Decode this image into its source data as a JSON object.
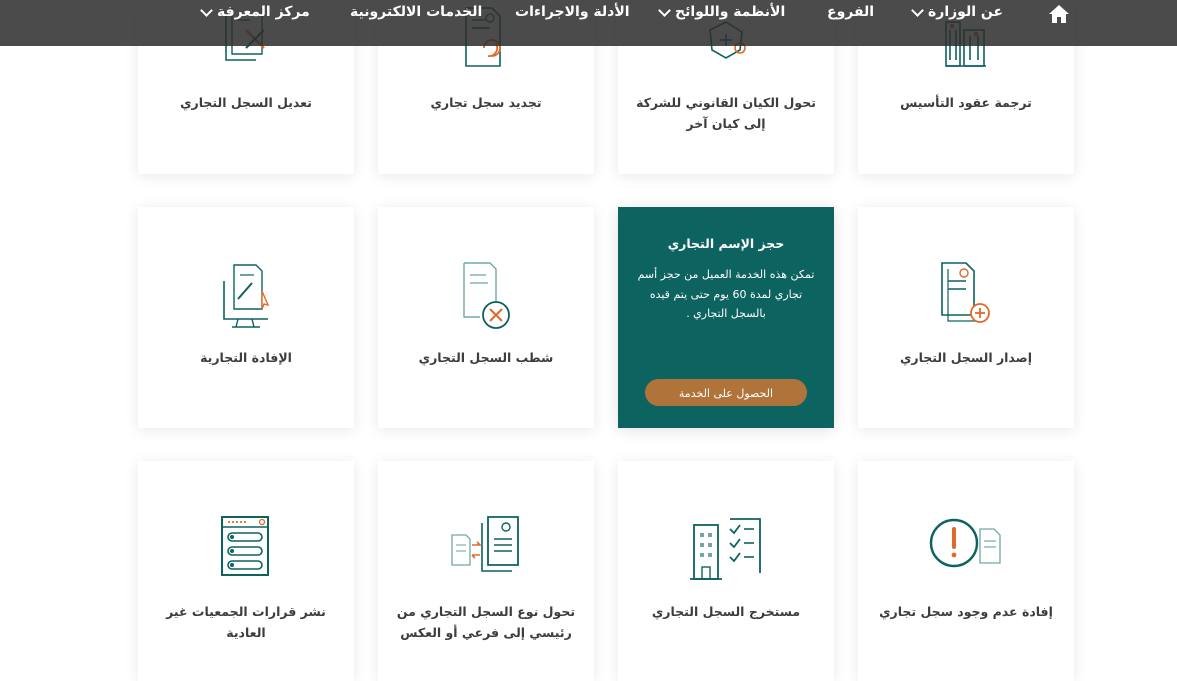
{
  "nav": {
    "items": [
      {
        "label": "عن الوزارة",
        "has_dropdown": true
      },
      {
        "label": "الفروع",
        "has_dropdown": false
      },
      {
        "label": "الأنظمة واللوائح",
        "has_dropdown": true
      },
      {
        "label": "الأدلة والاجراءات",
        "has_dropdown": false
      },
      {
        "label": "الخدمات الالكترونية",
        "has_dropdown": false
      },
      {
        "label": "مركز المعرفة",
        "has_dropdown": true
      }
    ],
    "home_icon": "home-icon"
  },
  "services": {
    "row1": [
      {
        "title": "ترجمة عقود التأسيس",
        "icon": "building-icon"
      },
      {
        "title": "تحول الكيان القانوني للشركة إلى كيان آخر",
        "icon": "map-transform-icon"
      },
      {
        "title": "تجديد سجل تجاري",
        "icon": "renew-document-icon"
      },
      {
        "title": "تعديل السجل التجاري",
        "icon": "edit-document-tools-icon"
      }
    ],
    "row2": [
      {
        "title": "إصدار السجل التجاري",
        "icon": "add-document-icon"
      },
      {
        "featured": true,
        "title": "حجز الإسم التجاري",
        "description": "تمكن هذه الخدمة العميل من حجز أسم تجاري لمدة 60 يوم حتى يتم قيده بالسجل التجاري .",
        "button": "الحصول على الخدمة"
      },
      {
        "title": "شطب السجل التجاري",
        "icon": "delete-document-icon"
      },
      {
        "title": "الإفادة التجارية",
        "icon": "computer-document-icon"
      }
    ],
    "row3": [
      {
        "title": "إفادة عدم وجود سجل تجاري",
        "icon": "exclamation-icon"
      },
      {
        "title": "مستخرج السجل التجاري",
        "icon": "building-checklist-icon"
      },
      {
        "title": "تحول نوع السجل التجاري من رئيسي إلى فرعي أو العكس",
        "icon": "document-exchange-icon"
      },
      {
        "title": "نشر قرارات الجمعيات غير العادية",
        "icon": "form-list-icon"
      }
    ]
  },
  "colors": {
    "teal": "#0d6360",
    "orange": "#e06a2c",
    "button": "#b0733a",
    "nav_bg": "#2d2d2d"
  }
}
